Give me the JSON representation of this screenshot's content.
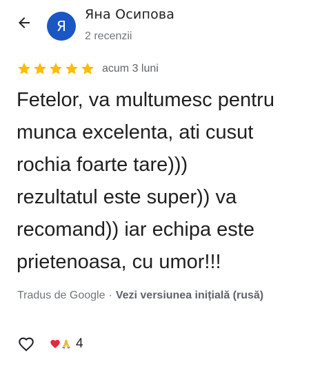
{
  "header": {
    "back_icon": "arrow-left-icon",
    "author": {
      "initial": "Я",
      "avatar_color": "#1a56c4",
      "name": "Яна Осипова",
      "reviews_count": "2 recenzii"
    }
  },
  "review": {
    "rating": 5,
    "rating_max": 5,
    "star_color": "#fbbc04",
    "date": "acum 3 luni",
    "text": "Fetelor, va multumesc pentru\nmunca excelenta, ati cusut\nrochia foarte tare)))\nrezultatul este super)) va\nrecomand)) iar echipa este\nprietenoasa, cu umor!!!"
  },
  "translation": {
    "source": "Tradus de Google",
    "separator": "·",
    "original_link": "Vezi versiunea inițială (rusă)"
  },
  "actions": {
    "like_icon": "heart-outline-icon",
    "reaction_icons": [
      "red-heart-icon",
      "folded-hands-icon"
    ],
    "reaction_count": "4"
  }
}
